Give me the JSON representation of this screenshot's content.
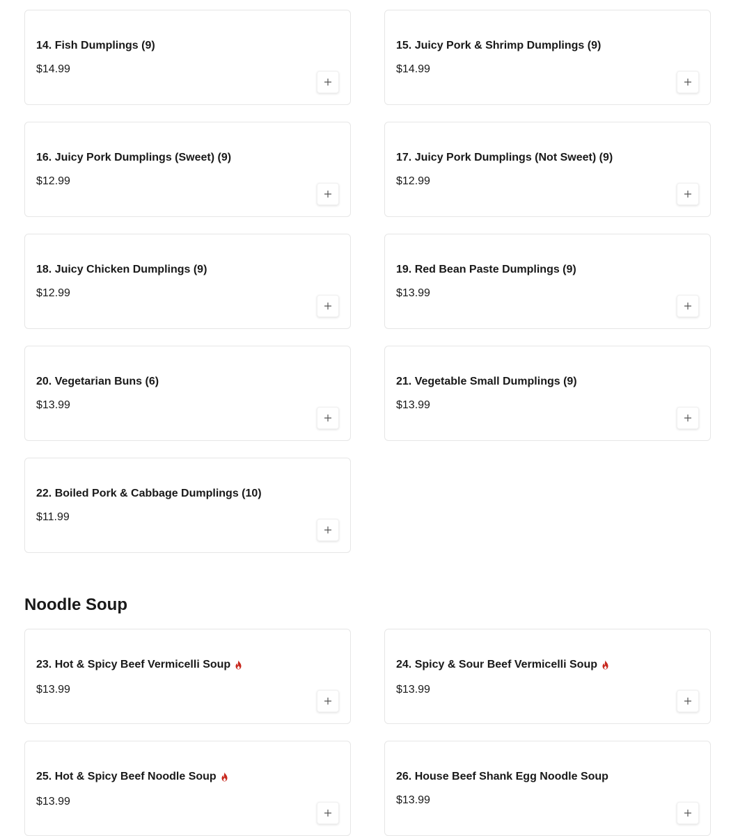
{
  "colors": {
    "spicy": "#c8281e",
    "text": "#191919",
    "border": "#e6e6e6"
  },
  "icons": {
    "add": "plus-icon",
    "spicy": "flame-icon"
  },
  "dumplings": {
    "items": [
      {
        "name": "14. Fish Dumplings (9)",
        "price": "$14.99"
      },
      {
        "name": "15. Juicy Pork & Shrimp Dumplings (9)",
        "price": "$14.99"
      },
      {
        "name": "16. Juicy Pork Dumplings (Sweet) (9)",
        "price": "$12.99"
      },
      {
        "name": "17. Juicy Pork Dumplings (Not Sweet) (9)",
        "price": "$12.99"
      },
      {
        "name": "18. Juicy Chicken Dumplings (9)",
        "price": "$12.99"
      },
      {
        "name": "19. Red Bean Paste Dumplings (9)",
        "price": "$13.99"
      },
      {
        "name": "20. Vegetarian Buns (6)",
        "price": "$13.99"
      },
      {
        "name": "21. Vegetable Small Dumplings (9)",
        "price": "$13.99"
      },
      {
        "name": "22. Boiled Pork & Cabbage Dumplings (10)",
        "price": "$11.99"
      }
    ]
  },
  "noodle_soup": {
    "title": "Noodle Soup",
    "items": [
      {
        "name": "23. Hot & Spicy Beef Vermicelli Soup",
        "price": "$13.99",
        "spicy": true
      },
      {
        "name": "24. Spicy & Sour Beef Vermicelli Soup",
        "price": "$13.99",
        "spicy": true
      },
      {
        "name": "25. Hot & Spicy Beef Noodle Soup",
        "price": "$13.99",
        "spicy": true
      },
      {
        "name": "26. House Beef Shank Egg Noodle Soup",
        "price": "$13.99",
        "spicy": false
      }
    ]
  }
}
